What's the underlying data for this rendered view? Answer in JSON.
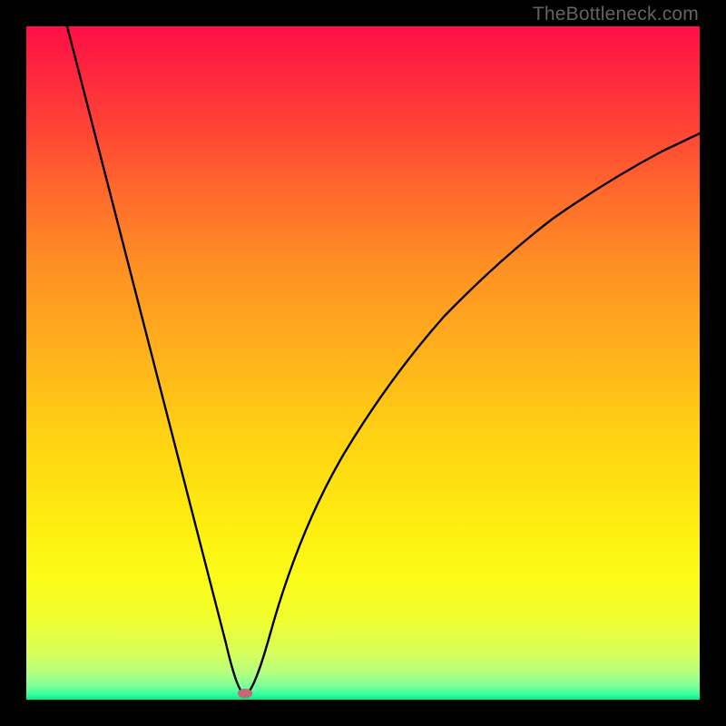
{
  "watermark": "TheBottleneck.com",
  "chart_data": {
    "type": "line",
    "title": "",
    "xlabel": "",
    "ylabel": "",
    "xlim": [
      0,
      100
    ],
    "ylim": [
      0,
      100
    ],
    "grid": false,
    "series": [
      {
        "name": "bottleneck-curve",
        "x": [
          6,
          10,
          14,
          18,
          22,
          26,
          29,
          31,
          32.5,
          34,
          36,
          40,
          45,
          50,
          55,
          60,
          65,
          70,
          75,
          80,
          85,
          90,
          95,
          100
        ],
        "y": [
          100,
          85,
          70,
          55,
          40,
          25,
          12,
          4,
          0.5,
          4,
          11,
          24,
          36,
          45,
          53,
          59,
          64,
          68,
          72,
          75,
          78,
          80.5,
          82.5,
          84
        ]
      }
    ],
    "marker": {
      "x": 32.5,
      "y": 0.9,
      "color": "#cc6677"
    },
    "background_gradient": {
      "top": "#ff0e46",
      "mid": "#ffb01c",
      "yellow": "#fcfc18",
      "bottom": "#08e67a"
    }
  }
}
